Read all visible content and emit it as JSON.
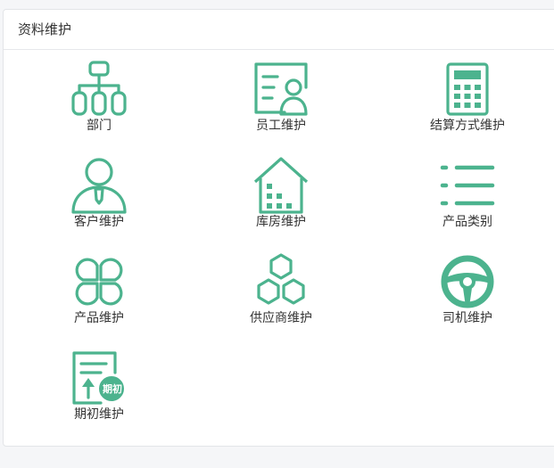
{
  "panel": {
    "title": "资料维护"
  },
  "theme": {
    "accent": "#4cb38e",
    "text": "#333333",
    "border": "#e3e5e8",
    "background": "#f5f6f8"
  },
  "items": [
    {
      "label": "部门",
      "icon": "department-org-chart-icon"
    },
    {
      "label": "员工维护",
      "icon": "employee-card-icon"
    },
    {
      "label": "结算方式维护",
      "icon": "calculator-icon"
    },
    {
      "label": "客户维护",
      "icon": "customer-person-icon"
    },
    {
      "label": "库房维护",
      "icon": "warehouse-icon"
    },
    {
      "label": "产品类别",
      "icon": "list-category-icon"
    },
    {
      "label": "产品维护",
      "icon": "product-clover-icon"
    },
    {
      "label": "供应商维护",
      "icon": "supplier-hexagons-icon"
    },
    {
      "label": "司机维护",
      "icon": "steering-wheel-icon"
    },
    {
      "label": "期初维护",
      "icon": "opening-balance-document-icon",
      "badge": "期初"
    }
  ]
}
